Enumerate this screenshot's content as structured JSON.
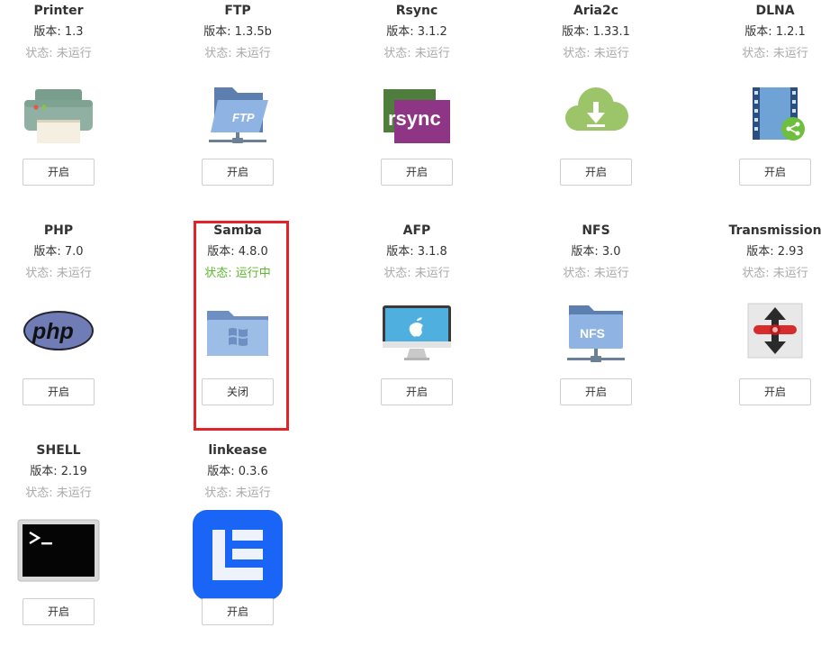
{
  "version_prefix": "版本: ",
  "status_prefix": "状态: ",
  "apps": [
    {
      "name": "Printer",
      "version": "1.3",
      "status": "未运行",
      "running": false,
      "button": "开启",
      "icon": "printer-icon"
    },
    {
      "name": "FTP",
      "version": "1.3.5b",
      "status": "未运行",
      "running": false,
      "button": "开启",
      "icon": "ftp-folder-icon"
    },
    {
      "name": "Rsync",
      "version": "3.1.2",
      "status": "未运行",
      "running": false,
      "button": "开启",
      "icon": "rsync-icon"
    },
    {
      "name": "Aria2c",
      "version": "1.33.1",
      "status": "未运行",
      "running": false,
      "button": "开启",
      "icon": "cloud-download-icon"
    },
    {
      "name": "DLNA",
      "version": "1.2.1",
      "status": "未运行",
      "running": false,
      "button": "开启",
      "icon": "dlna-media-icon"
    },
    {
      "name": "PHP",
      "version": "7.0",
      "status": "未运行",
      "running": false,
      "button": "开启",
      "icon": "php-icon"
    },
    {
      "name": "Samba",
      "version": "4.8.0",
      "status": "运行中",
      "running": true,
      "button": "关闭",
      "icon": "windows-folder-icon"
    },
    {
      "name": "AFP",
      "version": "3.1.8",
      "status": "未运行",
      "running": false,
      "button": "开启",
      "icon": "imac-apple-icon"
    },
    {
      "name": "NFS",
      "version": "3.0",
      "status": "未运行",
      "running": false,
      "button": "开启",
      "icon": "nfs-folder-icon"
    },
    {
      "name": "Transmission",
      "version": "2.93",
      "status": "未运行",
      "running": false,
      "button": "开启",
      "icon": "transmission-icon"
    },
    {
      "name": "SHELL",
      "version": "2.19",
      "status": "未运行",
      "running": false,
      "button": "开启",
      "icon": "terminal-icon"
    },
    {
      "name": "linkease",
      "version": "0.3.6",
      "status": "未运行",
      "running": false,
      "button": "开启",
      "icon": "linkease-icon"
    }
  ],
  "colors": {
    "status_running": "#5cb82c",
    "status_stopped": "#aaaaaa",
    "highlight_border": "#e2242a"
  }
}
